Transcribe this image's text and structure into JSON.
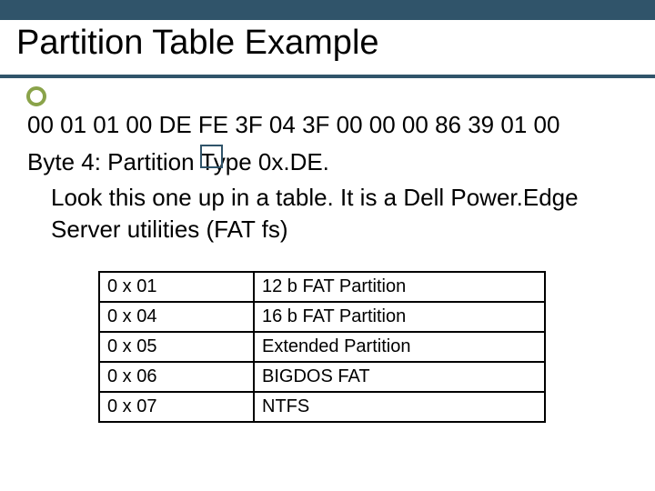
{
  "title": "Partition Table Example",
  "hex_bytes": "00 01 01 00 DE FE 3F 04 3F 00 00 00 86 39 01 00",
  "byte_line": "Byte 4: Partition Type 0x.DE.",
  "lookup_text": "Look this one up in a table. It is a Dell Power.Edge Server utilities (FAT fs)",
  "partition_types": [
    {
      "code": "0 x 01",
      "desc": "12 b FAT Partition"
    },
    {
      "code": "0 x 04",
      "desc": "16 b FAT Partition"
    },
    {
      "code": "0 x 05",
      "desc": "Extended Partition"
    },
    {
      "code": "0 x 06",
      "desc": "BIGDOS FAT"
    },
    {
      "code": "0 x 07",
      "desc": "NTFS"
    }
  ]
}
